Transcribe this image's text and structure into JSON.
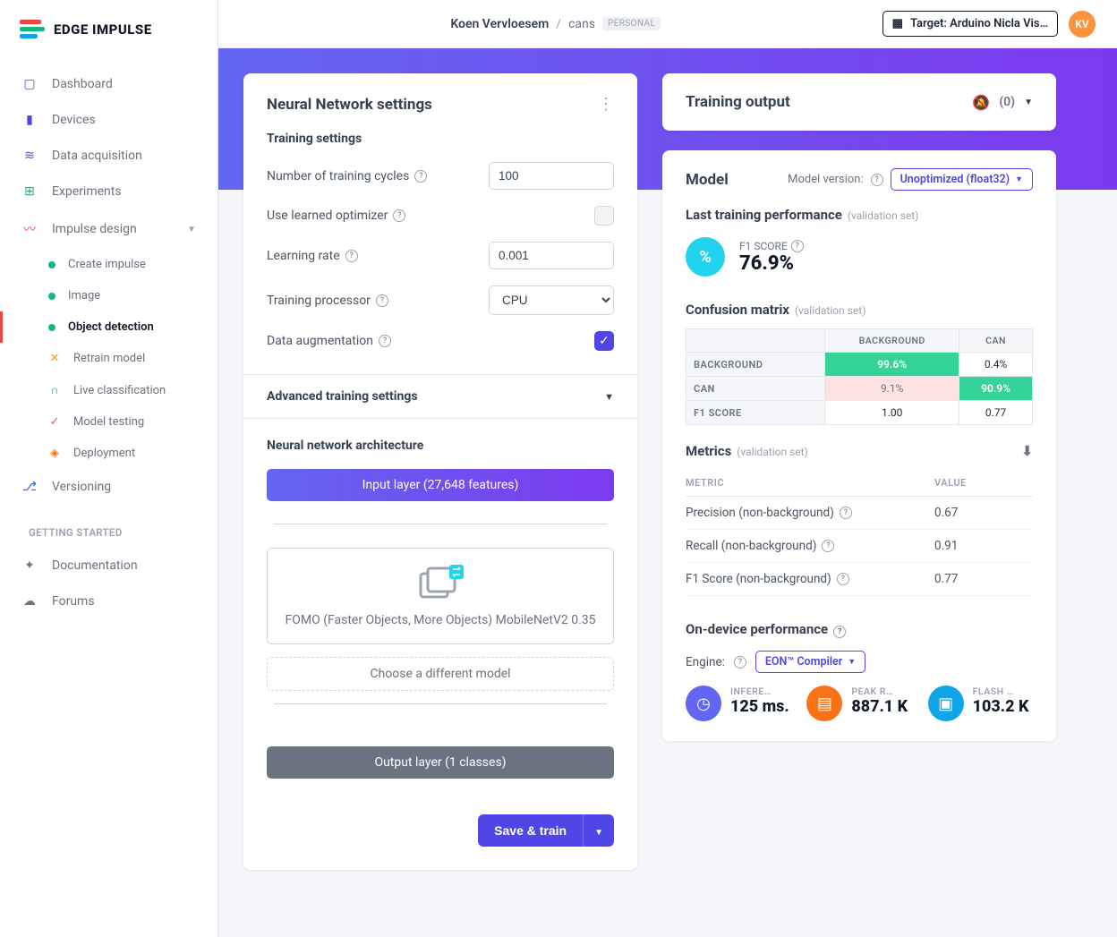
{
  "brand": "EDGE IMPULSE",
  "header": {
    "owner": "Koen Vervloesem",
    "project": "cans",
    "tag": "PERSONAL",
    "target_label": "Target: Arduino Nicla Vis…",
    "avatar": "KV"
  },
  "sidebar": {
    "items": [
      {
        "label": "Dashboard",
        "icon": "▭"
      },
      {
        "label": "Devices",
        "icon": "▮"
      },
      {
        "label": "Data acquisition",
        "icon": "≡"
      },
      {
        "label": "Experiments",
        "icon": "⊞"
      },
      {
        "label": "Impulse design",
        "icon": "〰"
      }
    ],
    "impulse_children": [
      {
        "label": "Create impulse",
        "kind": "dot"
      },
      {
        "label": "Image",
        "kind": "dot"
      },
      {
        "label": "Object detection",
        "kind": "dot",
        "active": true
      },
      {
        "label": "Retrain model",
        "kind": "icon"
      },
      {
        "label": "Live classification",
        "kind": "icon"
      },
      {
        "label": "Model testing",
        "kind": "icon"
      },
      {
        "label": "Deployment",
        "kind": "icon"
      }
    ],
    "versioning": "Versioning",
    "getting_started": "GETTING STARTED",
    "documentation": "Documentation",
    "forums": "Forums"
  },
  "left_card": {
    "title": "Neural Network settings",
    "training_title": "Training settings",
    "rows": {
      "cycles_label": "Number of training cycles",
      "cycles_value": "100",
      "learned_opt_label": "Use learned optimizer",
      "lr_label": "Learning rate",
      "lr_value": "0.001",
      "proc_label": "Training processor",
      "proc_value": "CPU",
      "aug_label": "Data augmentation"
    },
    "advanced": "Advanced training settings",
    "arch_title": "Neural network architecture",
    "input_layer": "Input layer (27,648 features)",
    "model_name": "FOMO (Faster Objects, More Objects) MobileNetV2 0.35",
    "choose_model": "Choose a different model",
    "output_layer": "Output layer (1 classes)",
    "save_btn": "Save & train"
  },
  "right": {
    "training_output": "Training output",
    "notif_count": "(0)",
    "model_title": "Model",
    "model_version_label": "Model version:",
    "model_version_value": "Unoptimized (float32)",
    "last_perf": "Last training performance",
    "val_set": "(validation set)",
    "f1_label": "F1 SCORE",
    "f1_value": "76.9%",
    "cm_title": "Confusion matrix",
    "cm": {
      "cols": [
        "BACKGROUND",
        "CAN"
      ],
      "rows": [
        {
          "hd": "BACKGROUND",
          "vals": [
            "99.6%",
            "0.4%"
          ],
          "good": [
            true,
            false
          ]
        },
        {
          "hd": "CAN",
          "vals": [
            "9.1%",
            "90.9%"
          ],
          "good": [
            false,
            true
          ]
        },
        {
          "hd": "F1 SCORE",
          "vals": [
            "1.00",
            "0.77"
          ],
          "plain": true
        }
      ]
    },
    "metrics_title": "Metrics",
    "metrics_cols": [
      "METRIC",
      "VALUE"
    ],
    "metrics": [
      {
        "label": "Precision (non-background)",
        "value": "0.67"
      },
      {
        "label": "Recall (non-background)",
        "value": "0.91"
      },
      {
        "label": "F1 Score (non-background)",
        "value": "0.77"
      }
    ],
    "ondevice": "On-device performance",
    "engine_label": "Engine:",
    "engine_value": "EON™ Compiler",
    "perf": [
      {
        "label": "INFERE…",
        "value": "125 ms."
      },
      {
        "label": "PEAK R…",
        "value": "887.1 K"
      },
      {
        "label": "FLASH …",
        "value": "103.2 K"
      }
    ]
  }
}
